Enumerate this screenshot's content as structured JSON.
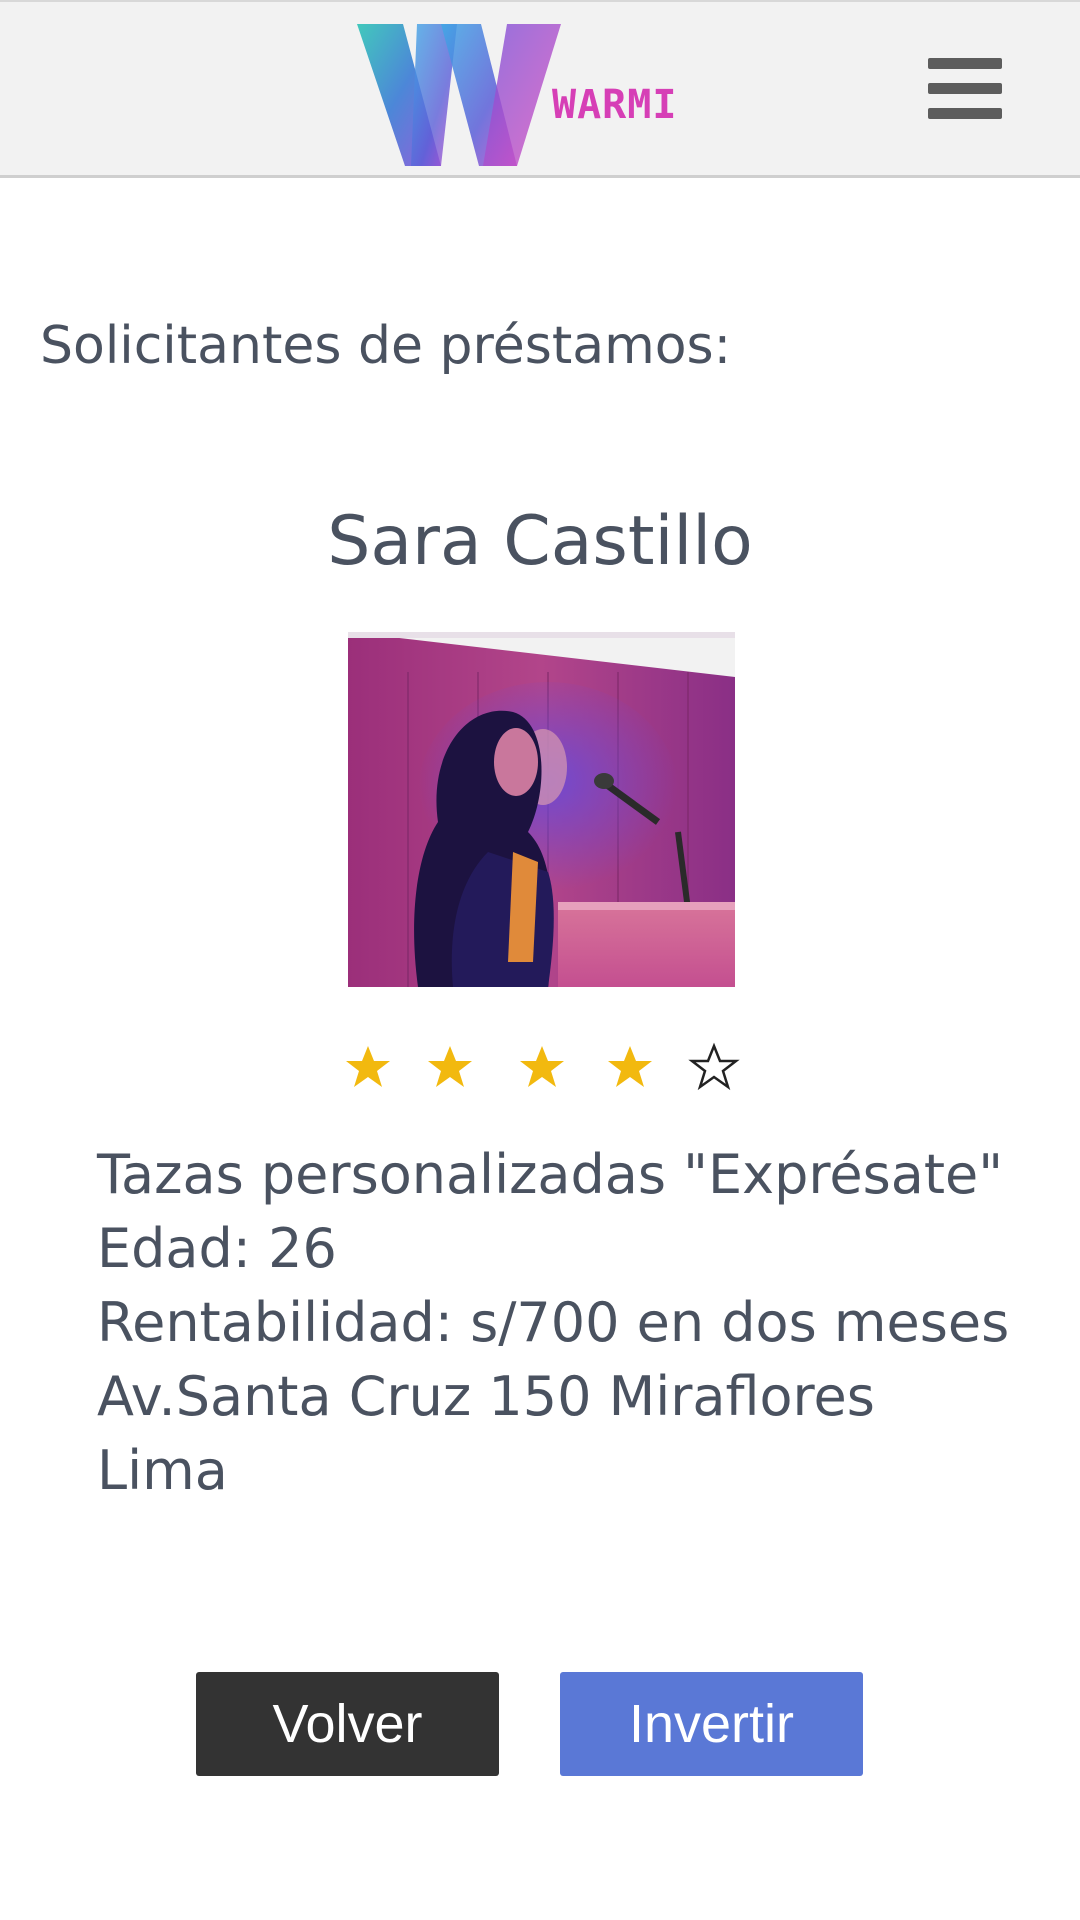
{
  "header": {
    "logo_letter": "W",
    "logo_text": "WARMI",
    "menu_icon": "hamburger-menu-icon"
  },
  "page": {
    "section_title": "Solicitantes de préstamos:"
  },
  "applicant": {
    "name": "Sara Castillo",
    "photo_alt": "photo",
    "rating": {
      "value": 4,
      "max": 5
    },
    "details": [
      "Tazas personalizadas \"Exprésate\"",
      "Edad: 26",
      "Rentabilidad: s/700 en dos meses",
      "Av.Santa Cruz 150 Miraflores",
      "Lima"
    ]
  },
  "actions": {
    "back_label": "Volver",
    "invest_label": "Invertir"
  },
  "colors": {
    "accent": "#5a78d6",
    "back_button": "#333333",
    "star": "#f2b90f",
    "logo_text": "#d63fb6"
  }
}
